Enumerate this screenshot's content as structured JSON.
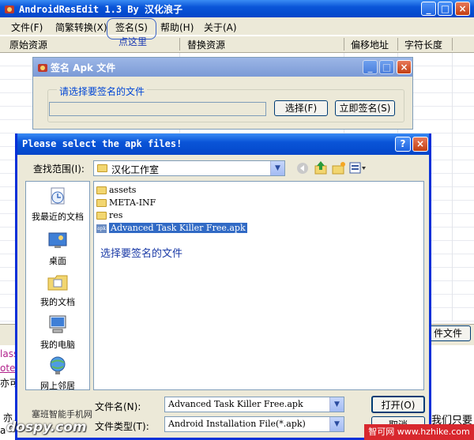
{
  "main_window": {
    "title": "AndroidResEdit 1.3 By 汉化浪子",
    "minimize": "_",
    "maximize": "□",
    "close": "×",
    "menu": [
      "文件(F)",
      "简繁转换(X)",
      "签名(S)",
      "帮助(H)",
      "关于(A)"
    ],
    "click_hint": "点这里",
    "columns": [
      "原始资源",
      "替换资源",
      "偏移地址",
      "字符长度"
    ],
    "behind_button": "件文件",
    "bottom_right_text": "我们只要",
    "fragments": [
      "lass",
      "otep",
      "亦可以",
      "亦",
      "a"
    ]
  },
  "sign_dialog": {
    "title": "签名 Apk 文件",
    "group_label": "请选择要签名的文件",
    "file_value": "",
    "choose_button": "选择(F)",
    "sign_now_button": "立即签名(S)",
    "close": "×"
  },
  "file_dialog": {
    "title": "Please select the apk files!",
    "help": "?",
    "close": "×",
    "lookin_label": "查找范围(I):",
    "lookin_value": "汉化工作室",
    "places": [
      "我最近的文档",
      "桌面",
      "我的文档",
      "我的电脑",
      "网上邻居"
    ],
    "files": [
      {
        "name": "assets",
        "type": "folder"
      },
      {
        "name": "META-INF",
        "type": "folder"
      },
      {
        "name": "res",
        "type": "folder"
      },
      {
        "name": "Advanced Task Killer Free.apk",
        "type": "apk",
        "selected": true
      }
    ],
    "annotation": "选择要签名的文件",
    "filename_label": "文件名(N):",
    "filename_value": "Advanced Task Killer Free.apk",
    "filetype_label": "文件类型(T):",
    "filetype_value": "Android Installation File(*.apk)",
    "open_button": "打开(O)",
    "cancel_button": "取消"
  },
  "watermarks": {
    "left_text": "塞班智能手机网",
    "logo": "dospy.com",
    "right": "智可网 www.hzhike.com"
  },
  "colors": {
    "xp_blue": "#0a55d8",
    "dialog_face": "#ece9d8",
    "selection": "#316ac5",
    "annotation": "#1a3aa6",
    "watermark_red": "#d8282e"
  }
}
